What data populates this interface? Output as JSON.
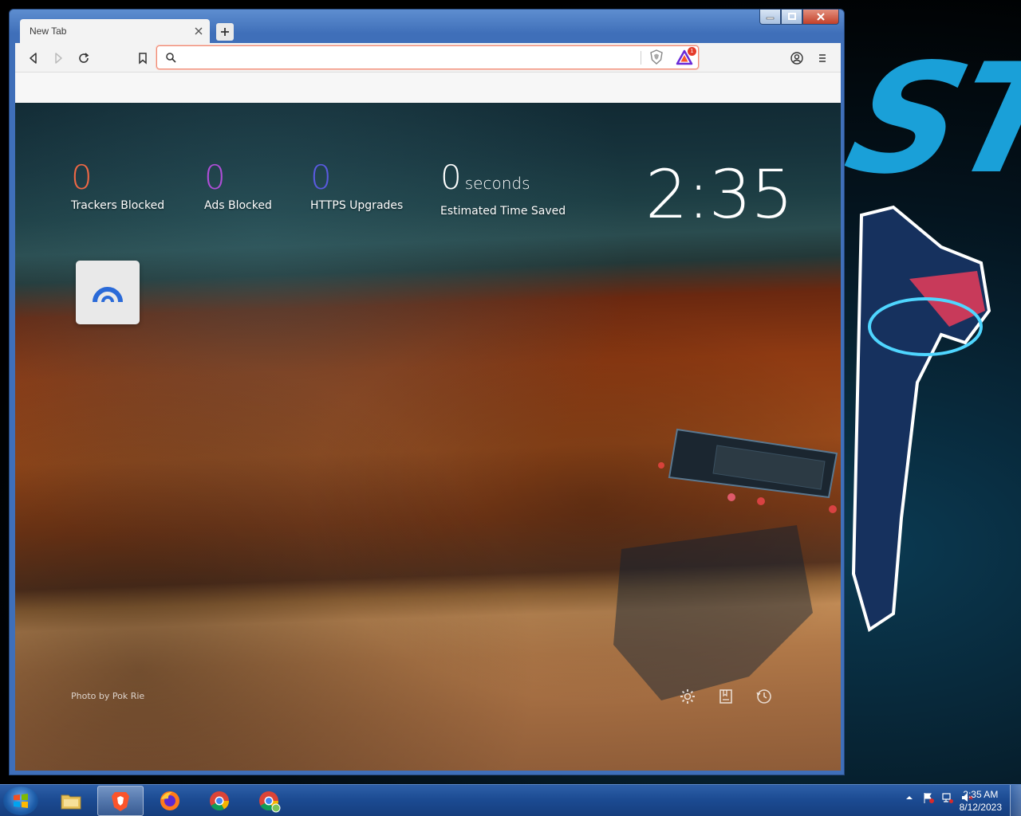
{
  "browser": {
    "tab_title": "New Tab",
    "url_value": "",
    "url_placeholder": "",
    "rewards_badge": "1"
  },
  "ntp": {
    "stats": [
      {
        "value": "0",
        "label": "Trackers Blocked",
        "color": "#f06845"
      },
      {
        "value": "0",
        "label": "Ads Blocked",
        "color": "#b04ed8"
      },
      {
        "value": "0",
        "label": "HTTPS Upgrades",
        "color": "#5a5ae0"
      }
    ],
    "time_saved": {
      "value": "0",
      "unit": "seconds",
      "label": "Estimated Time Saved"
    },
    "clock": "2:35",
    "photo_credit": "Photo by Pok Rie",
    "icons": [
      "gear-icon",
      "bookmarks-icon",
      "history-icon"
    ]
  },
  "taskbar": {
    "apps": [
      "windows-explorer",
      "brave",
      "firefox",
      "chrome",
      "chrome-canary"
    ],
    "time": "2:35 AM",
    "date": "8/12/2023"
  },
  "colors": {
    "accent_url_border": "#f08a74",
    "brave_orange": "#fb542b",
    "taskbar": "#1b4a91"
  }
}
